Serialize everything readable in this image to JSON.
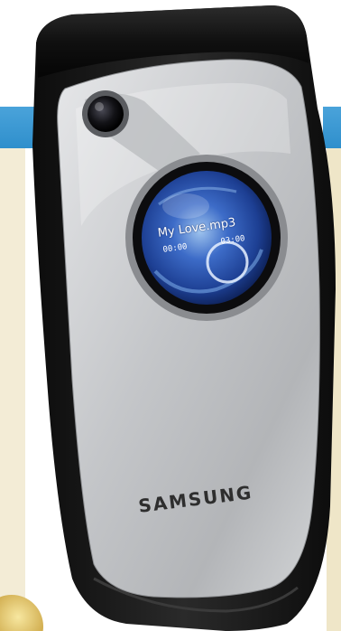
{
  "device": {
    "brand": "SAMSUNG",
    "body_color": "#1b1b1b",
    "face_color": "#c9cbce"
  },
  "external_display": {
    "track_title": "My Love.mp3",
    "elapsed_time": "00:00",
    "total_time": "03:00",
    "screen_color": "#2a56b8"
  },
  "background": {
    "band_color": "#2f8fcc",
    "panel_color": "#f3ecd6"
  }
}
